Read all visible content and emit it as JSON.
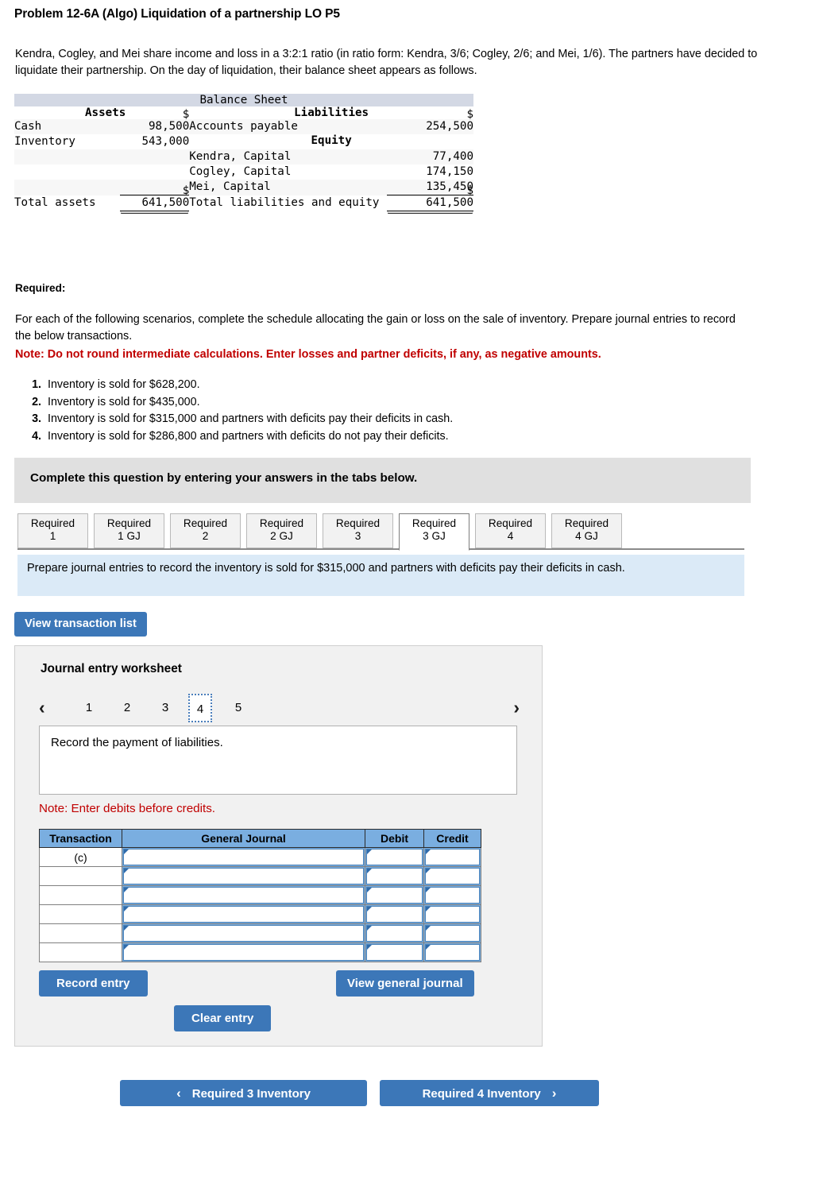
{
  "problem": {
    "title": "Problem 12-6A (Algo) Liquidation of a partnership LO P5",
    "intro": "Kendra, Cogley, and Mei share income and loss in a 3:2:1 ratio (in ratio form: Kendra, 3/6; Cogley, 2/6; and Mei, 1/6). The partners have decided to liquidate their partnership. On the day of liquidation, their balance sheet appears as follows."
  },
  "balance_sheet": {
    "title": "Balance Sheet",
    "assets_header": "Assets",
    "liabilities_header": "Liabilities",
    "equity_header": "Equity",
    "rows": {
      "cash_label": "Cash",
      "cash_dollar": "$",
      "cash_amount": "98,500",
      "inventory_label": "Inventory",
      "inventory_amount": "543,000",
      "ap_label": "Accounts payable",
      "ap_dollar": "$",
      "ap_amount": "254,500",
      "kendra_label": "Kendra, Capital",
      "kendra_amount": "77,400",
      "cogley_label": "Cogley, Capital",
      "cogley_amount": "174,150",
      "mei_label": "Mei, Capital",
      "mei_amount": "135,450",
      "total_assets_label": "Total assets",
      "total_assets_dollar": "$",
      "total_assets_amount": "641,500",
      "total_le_label": "Total liabilities and equity",
      "total_le_dollar": "$",
      "total_le_amount": "641,500"
    }
  },
  "required": {
    "label": "Required:",
    "body": "For each of the following scenarios, complete the schedule allocating the gain or loss on the sale of inventory. Prepare journal entries to record the below transactions.",
    "note": "Note: Do not round intermediate calculations. Enter losses and partner deficits, if any, as negative amounts.",
    "scenarios": [
      "Inventory is sold for $628,200.",
      "Inventory is sold for $435,000.",
      "Inventory is sold for $315,000 and partners with deficits pay their deficits in cash.",
      "Inventory is sold for $286,800 and partners with deficits do not pay their deficits."
    ]
  },
  "banner": {
    "text": "Complete this question by entering your answers in the tabs below."
  },
  "tabs": {
    "items": [
      {
        "line1": "Required",
        "line2": "1",
        "active": false
      },
      {
        "line1": "Required",
        "line2": "1 GJ",
        "active": false
      },
      {
        "line1": "Required",
        "line2": "2",
        "active": false
      },
      {
        "line1": "Required",
        "line2": "2 GJ",
        "active": false
      },
      {
        "line1": "Required",
        "line2": "3",
        "active": false
      },
      {
        "line1": "Required",
        "line2": "3 GJ",
        "active": true
      },
      {
        "line1": "Required",
        "line2": "4",
        "active": false
      },
      {
        "line1": "Required",
        "line2": "4 GJ",
        "active": false
      }
    ],
    "instruction": "Prepare journal entries to record the inventory is sold for $315,000 and partners with deficits pay their deficits in cash."
  },
  "worksheet": {
    "view_transaction_list_label": "View transaction list",
    "title": "Journal entry worksheet",
    "pages": [
      "1",
      "2",
      "3",
      "4",
      "5"
    ],
    "selected_page": "4",
    "prev_icon": "‹",
    "next_icon": "›",
    "description": "Record the payment of liabilities.",
    "note": "Note: Enter debits before credits.",
    "table": {
      "columns": [
        "Transaction",
        "General Journal",
        "Debit",
        "Credit"
      ],
      "rows": [
        {
          "transaction": "(c)",
          "general_journal": "",
          "debit": "",
          "credit": ""
        },
        {
          "transaction": "",
          "general_journal": "",
          "debit": "",
          "credit": ""
        },
        {
          "transaction": "",
          "general_journal": "",
          "debit": "",
          "credit": ""
        },
        {
          "transaction": "",
          "general_journal": "",
          "debit": "",
          "credit": ""
        },
        {
          "transaction": "",
          "general_journal": "",
          "debit": "",
          "credit": ""
        },
        {
          "transaction": "",
          "general_journal": "",
          "debit": "",
          "credit": ""
        }
      ]
    },
    "buttons": {
      "record_entry": "Record entry",
      "clear_entry": "Clear entry",
      "view_general_journal": "View general journal"
    }
  },
  "footer_nav": {
    "prev_label": "Required 3 Inventory",
    "next_label": "Required 4 Inventory",
    "prev_icon": "‹",
    "next_icon": "›"
  },
  "colors": {
    "accent_blue": "#3c77b8",
    "table_header_blue": "#7aaee0",
    "instruction_blue": "#dbeaf7",
    "banner_gray": "#e0e0e0",
    "note_red": "#c00000",
    "bs_title_blue": "#d3d8e4"
  }
}
